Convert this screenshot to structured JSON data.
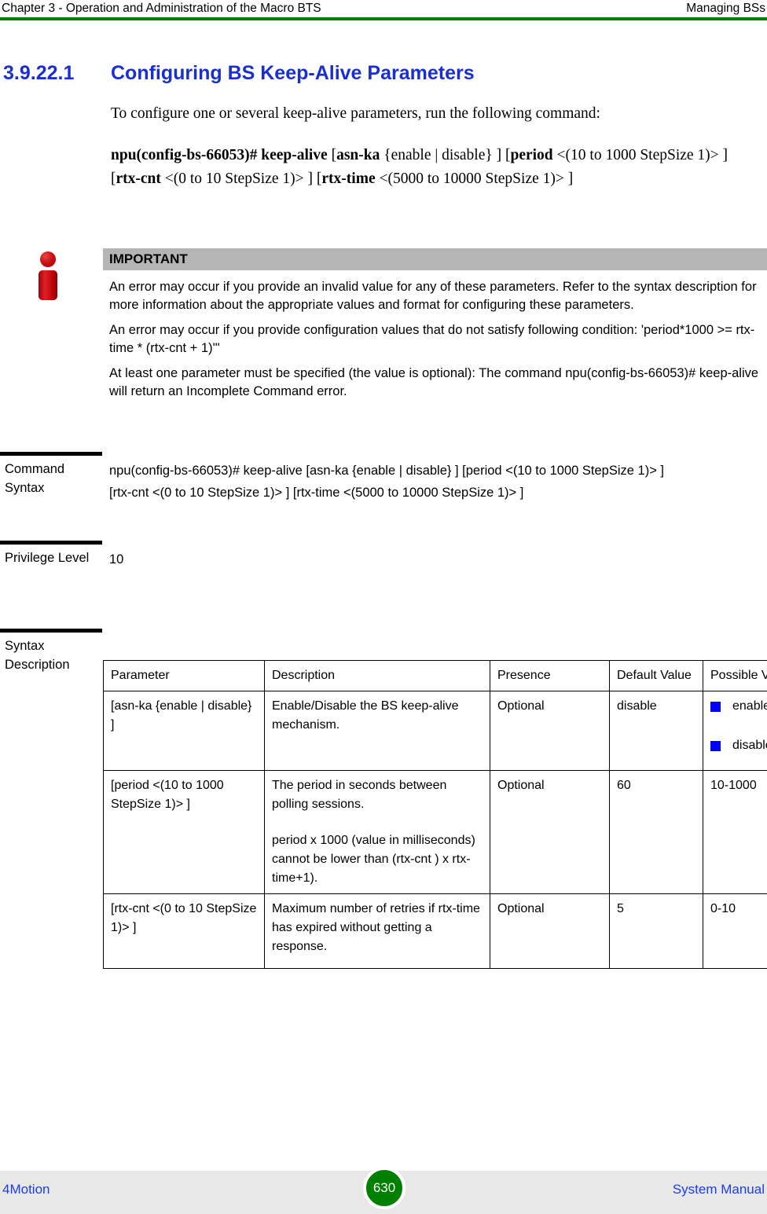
{
  "header": {
    "left": "Chapter 3 - Operation and Administration of the Macro BTS",
    "right": "Managing BSs",
    "rule_color": "#008000"
  },
  "section": {
    "number": "3.9.22.1",
    "title": "Configuring BS Keep-Alive Parameters",
    "heading_color": "#1a2fd0"
  },
  "intro": {
    "paragraph": "To configure one or several keep-alive parameters, run the following command:"
  },
  "command_line": {
    "prompt": "npu(config-bs-66053)# keep-alive",
    "part_asn_ka_open": "[",
    "asn_ka": "asn-ka",
    "asn_ka_values": "{enable | disable} ]",
    "period_open": "[",
    "period": "period",
    "period_range": "<(10 to 1000 StepSize 1)> ]",
    "rtx_cnt_open": "[",
    "rtx_cnt": "rtx-cnt",
    "rtx_cnt_range": "<(0 to 10 StepSize 1)> ]",
    "rtx_time_open": "[",
    "rtx_time": "rtx-time",
    "rtx_time_range": "<(5000 to 10000 StepSize 1)> ]"
  },
  "callout": {
    "icon": "info-icon",
    "icon_color": "#cc1216",
    "title": "IMPORTANT",
    "title_bar_color": "#b5b5b5",
    "paragraphs": [
      "An error may occur if you provide an invalid value for any of these parameters. Refer to the syntax description for more information about the appropriate values and format for configuring these parameters.",
      "An error may occur if you provide configuration values that do not satisfy following condition: 'period*1000 >= rtx-time * (rtx-cnt + 1)'\"",
      "At least one parameter must be specified (the value is optional): The command npu(config-bs-66053)# keep-alive will return an Incomplete Command error."
    ]
  },
  "fields": {
    "command_syntax": {
      "label": "Command Syntax",
      "line1": "npu(config-bs-66053)# keep-alive [asn-ka {enable | disable} ] [period <(10 to 1000 StepSize 1)> ]",
      "line2": "[rtx-cnt <(0 to 10 StepSize 1)> ] [rtx-time <(5000 to 10000 StepSize 1)> ]"
    },
    "privilege_level": {
      "label": "Privilege Level",
      "value": "10"
    },
    "syntax_description": {
      "label": "Syntax Description"
    }
  },
  "param_table": {
    "columns": [
      "Parameter",
      "Description",
      "Presence",
      "Default Value",
      "Possible Values"
    ],
    "rows": [
      {
        "parameter": "[asn-ka {enable | disable} ]",
        "description_1": "Enable/Disable the BS keep-alive mechanism.",
        "description_2": "",
        "presence": "Optional",
        "default_value": "disable",
        "possible_values_list": [
          "enable",
          "disable"
        ],
        "possible_values_text": ""
      },
      {
        "parameter": "[period <(10 to 1000 StepSize 1)> ]",
        "description_1": "The period in seconds between polling sessions.",
        "description_2": "period x 1000 (value in milliseconds) cannot be lower than (rtx-cnt ) x rtx-time+1).",
        "presence": "Optional",
        "default_value": "60",
        "possible_values_list": [],
        "possible_values_text": "10-1000"
      },
      {
        "parameter": "[rtx-cnt <(0 to 10 StepSize 1)> ]",
        "description_1": "Maximum number of retries if rtx-time has expired without getting a response.",
        "description_2": "",
        "presence": "Optional",
        "default_value": "5",
        "possible_values_list": [],
        "possible_values_text": "0-10"
      }
    ],
    "bullet_color": "#0000ff"
  },
  "footer": {
    "left": "4Motion",
    "page_number": "630",
    "right": "System Manual",
    "link_color": "#1a3ee8",
    "page_badge_color": "#008000"
  }
}
